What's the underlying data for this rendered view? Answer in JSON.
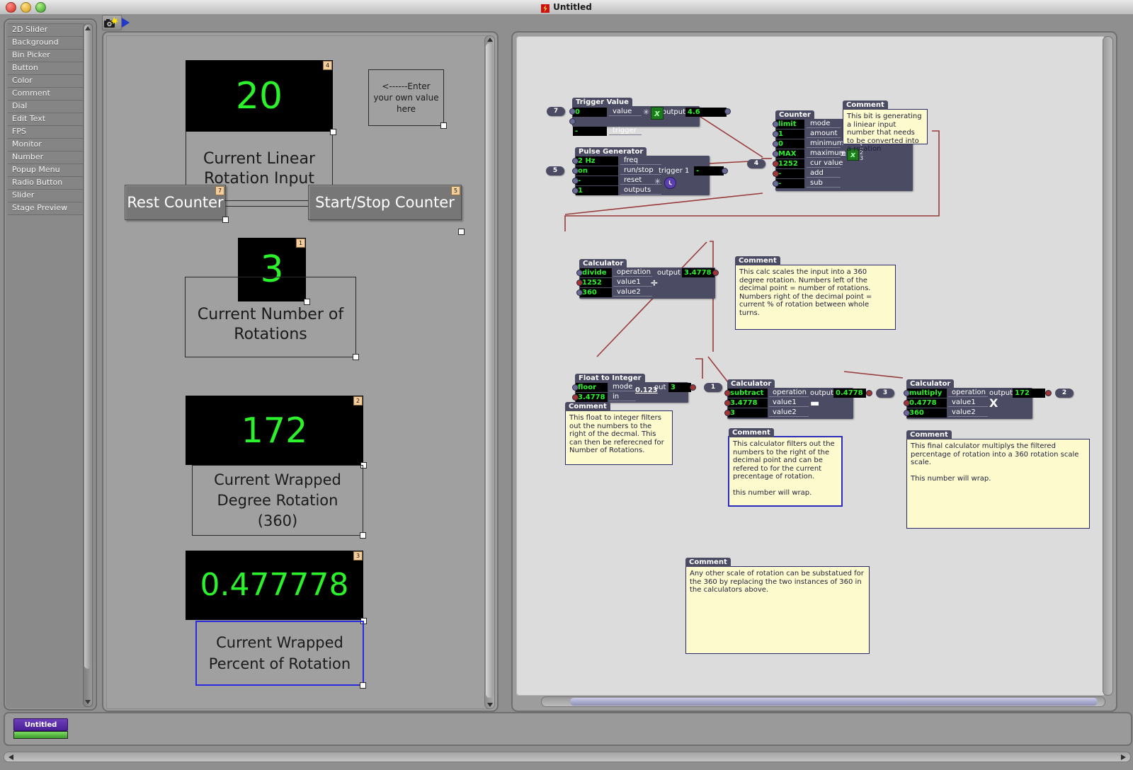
{
  "window": {
    "title": "Untitled",
    "icon": "app-icon",
    "traffic_lights": [
      "close",
      "minimize",
      "zoom"
    ]
  },
  "toolbar": {
    "snapshot_icon": "camera-icon",
    "run_icon": "play-triangle-icon"
  },
  "palette": {
    "items": [
      "2D Slider",
      "Background",
      "Bin Picker",
      "Button",
      "Color",
      "Comment",
      "Dial",
      "Edit Text",
      "FPS",
      "Monitor",
      "Number",
      "Popup Menu",
      "Radio Button",
      "Slider",
      "Stage Preview"
    ]
  },
  "stage": {
    "widgets": {
      "linear_input": {
        "value": "20",
        "number": "4",
        "caption": "Current Linear\nRotation Input"
      },
      "hint": {
        "text": "<------Enter\nyour own value\nhere"
      },
      "reset_button": {
        "label": "Rest Counter",
        "number": "7"
      },
      "startstop_button": {
        "label": "Start/Stop Counter",
        "number": "5"
      },
      "rotations": {
        "value": "3",
        "number": "1",
        "caption": "Current Number of\nRotations"
      },
      "degree": {
        "value": "172",
        "number": "2",
        "caption": "Current Wrapped\nDegree Rotation\n(360)"
      },
      "percent": {
        "value": "0.477778",
        "number": "3",
        "caption": "Current Wrapped\nPercent of Rotation"
      }
    }
  },
  "patch": {
    "nodes": [
      {
        "id": "trigger-value",
        "title": "Trigger Value",
        "inputs": [
          {
            "value": "0",
            "label": "value"
          },
          {
            "value": "-",
            "label": "trigger"
          }
        ],
        "outputs": [
          {
            "label": "output",
            "value": "4.6"
          }
        ],
        "op_icon": "x-box-icon",
        "in_badges": [
          "7"
        ]
      },
      {
        "id": "pulse-generator",
        "title": "Pulse Generator",
        "inputs": [
          {
            "value": "2 Hz",
            "label": "freq"
          },
          {
            "value": "on",
            "label": "run/stop"
          },
          {
            "value": "-",
            "label": "reset"
          },
          {
            "value": "1",
            "label": "outputs"
          }
        ],
        "outputs": [
          {
            "label": "trigger 1",
            "value": "-"
          }
        ],
        "op_icon": "clock-icon",
        "in_badges": [
          "5"
        ]
      },
      {
        "id": "counter",
        "title": "Counter",
        "inputs": [
          {
            "value": "limit",
            "label": "mode"
          },
          {
            "value": "1",
            "label": "amount"
          },
          {
            "value": "0",
            "label": "minimum"
          },
          {
            "value": "MAX",
            "label": "maximum"
          },
          {
            "value": "1252",
            "label": "cur value"
          },
          {
            "value": "-",
            "label": "add"
          },
          {
            "value": "-",
            "label": "sub"
          }
        ],
        "outputs": [
          {
            "label": "output",
            "value": "1252"
          }
        ],
        "op_icon": "plusminus-x-123-icon",
        "in_badges": [
          "4"
        ]
      },
      {
        "id": "calculator-divide",
        "title": "Calculator",
        "inputs": [
          {
            "value": "divide",
            "label": "operation"
          },
          {
            "value": "1252",
            "label": "value1"
          },
          {
            "value": "360",
            "label": "value2"
          }
        ],
        "outputs": [
          {
            "label": "output",
            "value": "3.4778"
          }
        ],
        "op_icon": "divide-icon"
      },
      {
        "id": "float-to-integer",
        "title": "Float to Integer",
        "inputs": [
          {
            "value": "floor",
            "label": "mode"
          },
          {
            "value": "3.4778",
            "label": "in"
          }
        ],
        "outputs": [
          {
            "label": "out",
            "value": "3"
          }
        ],
        "op_icon": "0.123-icon",
        "out_badges": [
          "1"
        ]
      },
      {
        "id": "calculator-subtract",
        "title": "Calculator",
        "inputs": [
          {
            "value": "subtract",
            "label": "operation"
          },
          {
            "value": "3.4778",
            "label": "value1"
          },
          {
            "value": "3",
            "label": "value2"
          }
        ],
        "outputs": [
          {
            "label": "output",
            "value": "0.4778"
          }
        ],
        "op_icon": "minus-icon",
        "out_badges": [
          "3"
        ]
      },
      {
        "id": "calculator-multiply",
        "title": "Calculator",
        "inputs": [
          {
            "value": "multiply",
            "label": "operation"
          },
          {
            "value": "0.4778",
            "label": "value1"
          },
          {
            "value": "360",
            "label": "value2"
          }
        ],
        "outputs": [
          {
            "label": "output",
            "value": "172"
          }
        ],
        "op_icon": "multiply-icon",
        "out_badges": [
          "2"
        ]
      }
    ],
    "comments": [
      {
        "id": "comment-linear",
        "title": "Comment",
        "text": "This bit is generating a liniear input number that needs to be converted into a rotation"
      },
      {
        "id": "comment-scale360",
        "title": "Comment",
        "text": "This calc scales the input into a 360 degree rotation. Numbers left of the decimal point = number of rotations. Numbers right of the decimal point = current % of rotation between whole turns."
      },
      {
        "id": "comment-float",
        "title": "Comment",
        "text": "This float to integer filters out the numbers to the right of the decmal. This can then be referecned for Number of Rotations."
      },
      {
        "id": "comment-subtract",
        "title": "Comment",
        "text": "This calculator filters out the numbers to the right of the decimal point and can be refered to for the current precentage of rotation.\n\nthis number will wrap."
      },
      {
        "id": "comment-multiply",
        "title": "Comment",
        "text": "This final calculator multiplys the filtered percentage of rotation into a 360 rotation scale scale.\n\nThis number will wrap."
      },
      {
        "id": "comment-anyscale",
        "title": "Comment",
        "text": "Any other scale of rotation can be substatued for the 360 by replacing the two instances of 360 in the calculators above."
      }
    ]
  },
  "bottom": {
    "document_tab": "Untitled"
  },
  "colors": {
    "green_value": "#2bf22b",
    "node_body": "#4b4b63",
    "comment_bg": "#fdfbcd",
    "wire": "#9a3b3b",
    "selection": "#2b2bbb",
    "tab_purple": "#4a1f95",
    "progress_green": "#3c9b2a"
  }
}
